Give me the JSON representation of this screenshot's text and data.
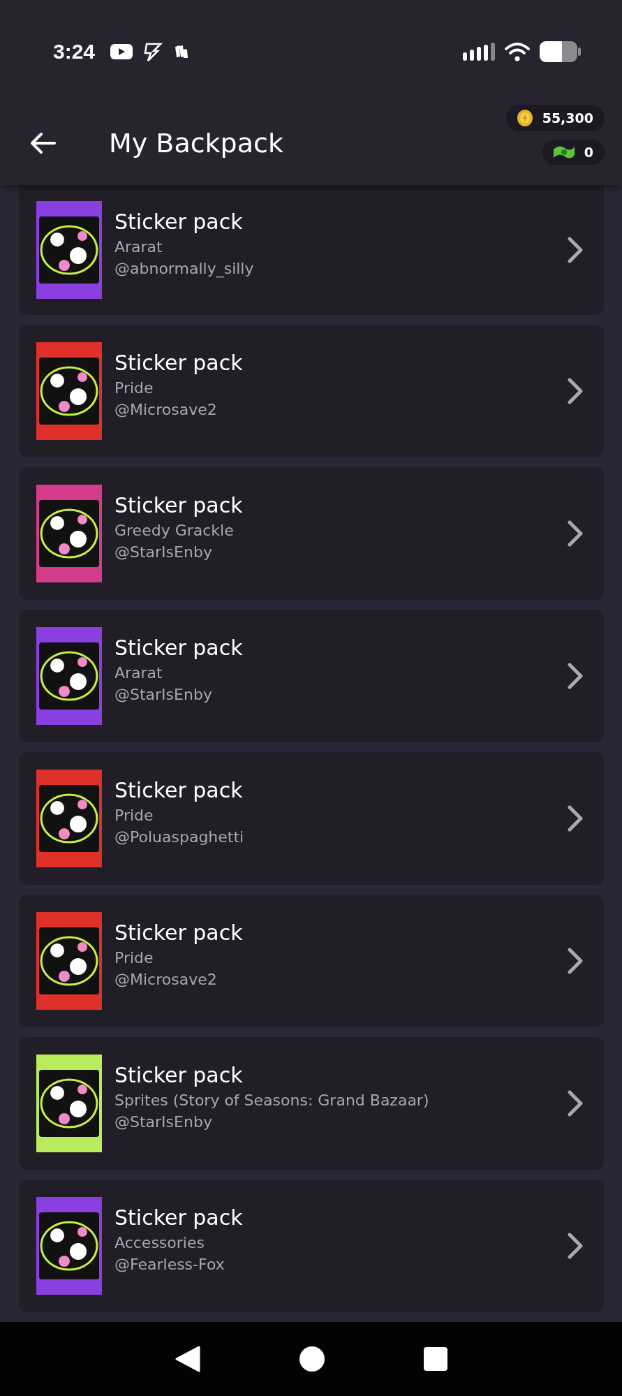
{
  "status_bar": {
    "time": "3:24"
  },
  "header": {
    "title": "My Backpack",
    "coins": "55,300",
    "cash": "0"
  },
  "items": [
    {
      "title": "Sticker pack",
      "name": "Ararat",
      "author": "@abnormally_silly",
      "color": "#8a3fe0"
    },
    {
      "title": "Sticker pack",
      "name": "Pride",
      "author": "@Microsave2",
      "color": "#e0302a"
    },
    {
      "title": "Sticker pack",
      "name": "Greedy Grackle",
      "author": "@StarIsEnby",
      "color": "#d43c8a"
    },
    {
      "title": "Sticker pack",
      "name": "Ararat",
      "author": "@StarIsEnby",
      "color": "#8a3fe0"
    },
    {
      "title": "Sticker pack",
      "name": "Pride",
      "author": "@Poluaspaghetti",
      "color": "#e0302a"
    },
    {
      "title": "Sticker pack",
      "name": "Pride",
      "author": "@Microsave2",
      "color": "#e0302a"
    },
    {
      "title": "Sticker pack",
      "name": "Sprites (Story of Seasons: Grand Bazaar)",
      "author": "@StarIsEnby",
      "color": "#b8ec5c"
    },
    {
      "title": "Sticker pack",
      "name": "Accessories",
      "author": "@Fearless-Fox",
      "color": "#8a3fe0"
    }
  ]
}
